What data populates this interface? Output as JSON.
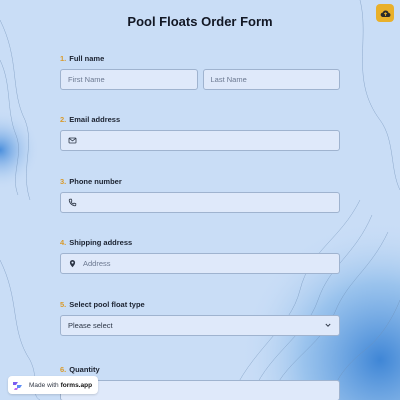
{
  "form": {
    "title": "Pool Floats Order Form",
    "corner_icon": "cloud-upload-icon"
  },
  "questions": [
    {
      "num": "1.",
      "label": "Full name",
      "first_placeholder": "First Name",
      "last_placeholder": "Last Name"
    },
    {
      "num": "2.",
      "label": "Email address",
      "icon": "email-icon"
    },
    {
      "num": "3.",
      "label": "Phone number",
      "icon": "phone-icon"
    },
    {
      "num": "4.",
      "label": "Shipping address",
      "icon": "location-pin-icon",
      "placeholder": "Address"
    },
    {
      "num": "5.",
      "label": "Select pool float type",
      "selected": "Please select",
      "icon": "chevron-down-icon"
    },
    {
      "num": "6.",
      "label": "Quantity"
    }
  ],
  "badge": {
    "prefix": "Made with",
    "brand": "forms.app"
  },
  "colors": {
    "background": "#c9ddf6",
    "accent": "#e9b02a",
    "field": "#dfe9fa",
    "number": "#d99a2b"
  }
}
